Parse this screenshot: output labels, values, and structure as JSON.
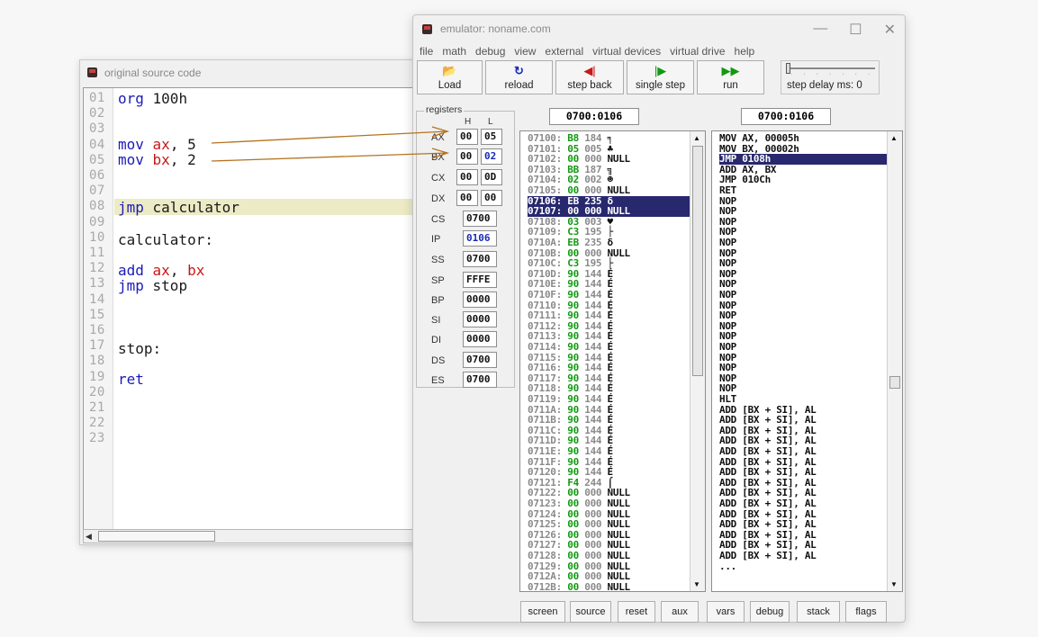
{
  "source_window": {
    "title": "original source code",
    "line_numbers": [
      "01",
      "02",
      "03",
      "04",
      "05",
      "06",
      "07",
      "08",
      "09",
      "10",
      "11",
      "12",
      "13",
      "14",
      "15",
      "16",
      "17",
      "18",
      "19",
      "20",
      "21",
      "22",
      "23"
    ],
    "code": {
      "l01_kw": "org",
      "l01_rest": " 100h",
      "l04_kw": "mov",
      "l04_reg": "ax",
      "l04_rest": ", 5",
      "l05_kw": "mov",
      "l05_reg": "bx",
      "l05_rest": ", 2",
      "l08_kw": "jmp",
      "l08_rest": " calculator",
      "l10": "calculator:",
      "l12_kw": "add",
      "l12_reg1": "ax",
      "l12_sep": ", ",
      "l12_reg2": "bx",
      "l13_kw": "jmp",
      "l13_rest": " stop",
      "l17": "stop:",
      "l19_kw": "ret"
    },
    "colors": {
      "keyword": "#1a1ab8",
      "register": "#c81818",
      "current_line": "#ecebc6"
    }
  },
  "emulator": {
    "title": "emulator: noname.com",
    "menu": [
      "file",
      "math",
      "debug",
      "view",
      "external",
      "virtual devices",
      "virtual drive",
      "help"
    ],
    "toolbar": {
      "load": "Load",
      "reload": "reload",
      "step_back": "step back",
      "single_step": "single step",
      "run": "run",
      "step_delay": "step delay ms: 0"
    },
    "registers": {
      "legend": "registers",
      "h_header": "H",
      "l_header": "L",
      "ax_name": "AX",
      "ax_h": "00",
      "ax_l": "05",
      "bx_name": "BX",
      "bx_h": "00",
      "bx_l": "02",
      "cx_name": "CX",
      "cx_h": "00",
      "cx_l": "0D",
      "dx_name": "DX",
      "dx_h": "00",
      "dx_l": "00",
      "cs_name": "CS",
      "cs": "0700",
      "ip_name": "IP",
      "ip": "0106",
      "ss_name": "SS",
      "ss": "0700",
      "sp_name": "SP",
      "sp": "FFFE",
      "bp_name": "BP",
      "bp": "0000",
      "si_name": "SI",
      "si": "0000",
      "di_name": "DI",
      "di": "0000",
      "ds_name": "DS",
      "ds": "0700",
      "es_name": "ES",
      "es": "0700"
    },
    "memory_address": "0700:0106",
    "disasm_address": "0700:0106",
    "memory": [
      {
        "addr": "07100:",
        "hex": "B8",
        "dec": "184",
        "chr": "╕"
      },
      {
        "addr": "07101:",
        "hex": "05",
        "dec": "005",
        "chr": "♣"
      },
      {
        "addr": "07102:",
        "hex": "00",
        "dec": "000",
        "chr": "NULL"
      },
      {
        "addr": "07103:",
        "hex": "BB",
        "dec": "187",
        "chr": "╗"
      },
      {
        "addr": "07104:",
        "hex": "02",
        "dec": "002",
        "chr": "☻"
      },
      {
        "addr": "07105:",
        "hex": "00",
        "dec": "000",
        "chr": "NULL"
      },
      {
        "addr": "07106:",
        "hex": "EB",
        "dec": "235",
        "chr": "δ"
      },
      {
        "addr": "07107:",
        "hex": "00",
        "dec": "000",
        "chr": "NULL"
      },
      {
        "addr": "07108:",
        "hex": "03",
        "dec": "003",
        "chr": "♥"
      },
      {
        "addr": "07109:",
        "hex": "C3",
        "dec": "195",
        "chr": "├"
      },
      {
        "addr": "0710A:",
        "hex": "EB",
        "dec": "235",
        "chr": "δ"
      },
      {
        "addr": "0710B:",
        "hex": "00",
        "dec": "000",
        "chr": "NULL"
      },
      {
        "addr": "0710C:",
        "hex": "C3",
        "dec": "195",
        "chr": "├"
      },
      {
        "addr": "0710D:",
        "hex": "90",
        "dec": "144",
        "chr": "É"
      },
      {
        "addr": "0710E:",
        "hex": "90",
        "dec": "144",
        "chr": "É"
      },
      {
        "addr": "0710F:",
        "hex": "90",
        "dec": "144",
        "chr": "É"
      },
      {
        "addr": "07110:",
        "hex": "90",
        "dec": "144",
        "chr": "É"
      },
      {
        "addr": "07111:",
        "hex": "90",
        "dec": "144",
        "chr": "É"
      },
      {
        "addr": "07112:",
        "hex": "90",
        "dec": "144",
        "chr": "É"
      },
      {
        "addr": "07113:",
        "hex": "90",
        "dec": "144",
        "chr": "É"
      },
      {
        "addr": "07114:",
        "hex": "90",
        "dec": "144",
        "chr": "É"
      },
      {
        "addr": "07115:",
        "hex": "90",
        "dec": "144",
        "chr": "É"
      },
      {
        "addr": "07116:",
        "hex": "90",
        "dec": "144",
        "chr": "É"
      },
      {
        "addr": "07117:",
        "hex": "90",
        "dec": "144",
        "chr": "É"
      },
      {
        "addr": "07118:",
        "hex": "90",
        "dec": "144",
        "chr": "É"
      },
      {
        "addr": "07119:",
        "hex": "90",
        "dec": "144",
        "chr": "É"
      },
      {
        "addr": "0711A:",
        "hex": "90",
        "dec": "144",
        "chr": "É"
      },
      {
        "addr": "0711B:",
        "hex": "90",
        "dec": "144",
        "chr": "É"
      },
      {
        "addr": "0711C:",
        "hex": "90",
        "dec": "144",
        "chr": "É"
      },
      {
        "addr": "0711D:",
        "hex": "90",
        "dec": "144",
        "chr": "É"
      },
      {
        "addr": "0711E:",
        "hex": "90",
        "dec": "144",
        "chr": "É"
      },
      {
        "addr": "0711F:",
        "hex": "90",
        "dec": "144",
        "chr": "É"
      },
      {
        "addr": "07120:",
        "hex": "90",
        "dec": "144",
        "chr": "É"
      },
      {
        "addr": "07121:",
        "hex": "F4",
        "dec": "244",
        "chr": "⌠"
      },
      {
        "addr": "07122:",
        "hex": "00",
        "dec": "000",
        "chr": "NULL"
      },
      {
        "addr": "07123:",
        "hex": "00",
        "dec": "000",
        "chr": "NULL"
      },
      {
        "addr": "07124:",
        "hex": "00",
        "dec": "000",
        "chr": "NULL"
      },
      {
        "addr": "07125:",
        "hex": "00",
        "dec": "000",
        "chr": "NULL"
      },
      {
        "addr": "07126:",
        "hex": "00",
        "dec": "000",
        "chr": "NULL"
      },
      {
        "addr": "07127:",
        "hex": "00",
        "dec": "000",
        "chr": "NULL"
      },
      {
        "addr": "07128:",
        "hex": "00",
        "dec": "000",
        "chr": "NULL"
      },
      {
        "addr": "07129:",
        "hex": "00",
        "dec": "000",
        "chr": "NULL"
      },
      {
        "addr": "0712A:",
        "hex": "00",
        "dec": "000",
        "chr": "NULL"
      },
      {
        "addr": "0712B:",
        "hex": "00",
        "dec": "000",
        "chr": "NULL"
      }
    ],
    "memory_selected": [
      "07106:",
      "07107:"
    ],
    "disassembly": [
      "MOV AX, 00005h",
      "MOV BX, 00002h",
      "JMP 0108h",
      "ADD AX, BX",
      "JMP 010Ch",
      "RET",
      "NOP",
      "NOP",
      "NOP",
      "NOP",
      "NOP",
      "NOP",
      "NOP",
      "NOP",
      "NOP",
      "NOP",
      "NOP",
      "NOP",
      "NOP",
      "NOP",
      "NOP",
      "NOP",
      "NOP",
      "NOP",
      "NOP",
      "HLT",
      "ADD [BX + SI], AL",
      "ADD [BX + SI], AL",
      "ADD [BX + SI], AL",
      "ADD [BX + SI], AL",
      "ADD [BX + SI], AL",
      "ADD [BX + SI], AL",
      "ADD [BX + SI], AL",
      "ADD [BX + SI], AL",
      "ADD [BX + SI], AL",
      "ADD [BX + SI], AL",
      "ADD [BX + SI], AL",
      "ADD [BX + SI], AL",
      "ADD [BX + SI], AL",
      "ADD [BX + SI], AL",
      "ADD [BX + SI], AL",
      "..."
    ],
    "disassembly_selected": "JMP 0108h",
    "bottom_buttons": [
      "screen",
      "source",
      "reset",
      "aux",
      "vars",
      "debug",
      "stack",
      "flags"
    ],
    "colors": {
      "selection": "#28286e",
      "hex_value": "#119911",
      "value_changed": "#1a2ab8",
      "arrow": "#b5731e"
    }
  }
}
